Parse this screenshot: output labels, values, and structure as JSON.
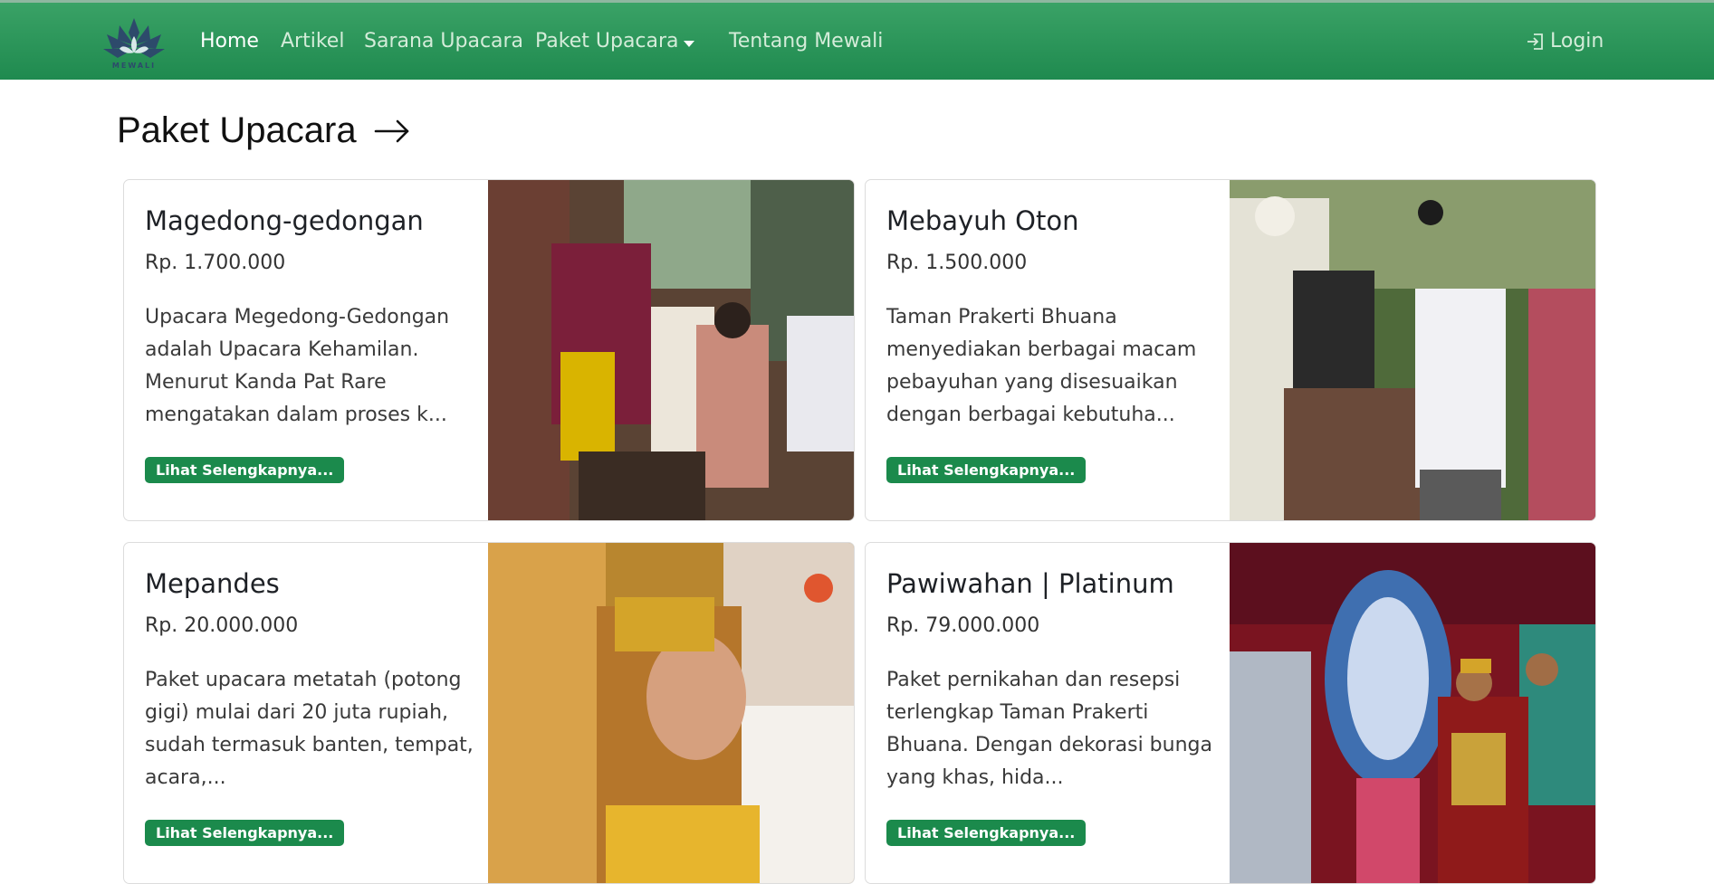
{
  "nav": {
    "logo_text": "MEWALI",
    "links": [
      "Home",
      "Artikel",
      "Sarana Upacara",
      "Paket Upacara",
      "Tentang Mewali"
    ],
    "login_label": "Login"
  },
  "page": {
    "title": "Paket Upacara"
  },
  "cards": [
    {
      "title": "Magedong-gedongan",
      "price": "Rp. 1.700.000",
      "description": "Upacara Megedong-Gedongan adalah Upacara Kehamilan. Menurut Kanda Pat Rare mengatakan dalam proses k...",
      "button": "Lihat Selengkapnya..."
    },
    {
      "title": "Mebayuh Oton",
      "price": "Rp. 1.500.000",
      "description": "Taman Prakerti Bhuana menyediakan berbagai macam pebayuhan yang disesuaikan dengan berbagai kebutuha...",
      "button": "Lihat Selengkapnya..."
    },
    {
      "title": "Mepandes",
      "price": "Rp. 20.000.000",
      "description": "Paket upacara metatah (potong gigi) mulai dari 20 juta rupiah, sudah termasuk banten, tempat, acara,...",
      "button": "Lihat Selengkapnya..."
    },
    {
      "title": "Pawiwahan | Platinum",
      "price": "Rp. 79.000.000",
      "description": "Paket pernikahan dan resepsi terlengkap Taman Prakerti Bhuana. Dengan dekorasi bunga yang khas, hida...",
      "button": "Lihat Selengkapnya..."
    }
  ]
}
